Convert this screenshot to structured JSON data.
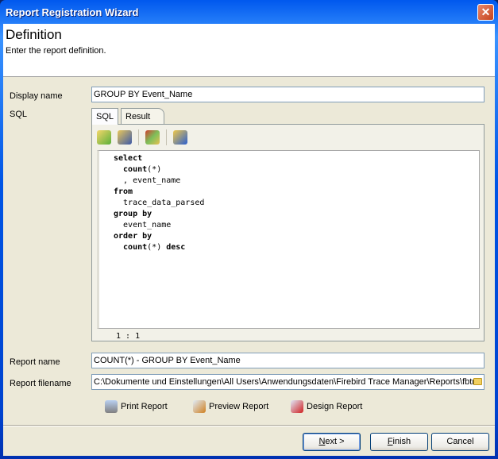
{
  "window": {
    "title": "Report Registration Wizard",
    "close": "✕"
  },
  "header": {
    "title": "Definition",
    "subtitle": "Enter the report definition."
  },
  "form": {
    "display_name_label": "Display name",
    "display_name_value": "GROUP BY Event_Name",
    "sql_label": "SQL",
    "report_name_label": "Report name",
    "report_name_value": "COUNT(*) - GROUP BY Event_Name",
    "report_filename_label": "Report filename",
    "report_filename_value": "C:\\Dokumente und Einstellungen\\All Users\\Anwendungsdaten\\Firebird Trace Manager\\Reports\\fbtr"
  },
  "tabs": [
    {
      "label": "SQL",
      "active": true
    },
    {
      "label": "Result",
      "active": false
    }
  ],
  "toolbar": {
    "icons": [
      "open-icon",
      "save-icon",
      "query-builder-icon",
      "execute-icon"
    ]
  },
  "editor": {
    "lines": [
      {
        "kw": "select",
        "rest": ""
      },
      {
        "kw": "  count",
        "rest": "(*)"
      },
      {
        "kw": "",
        "rest": "  , event_name"
      },
      {
        "kw": "from",
        "rest": ""
      },
      {
        "kw": "",
        "rest": "  trace_data_parsed"
      },
      {
        "kw": "group by",
        "rest": ""
      },
      {
        "kw": "",
        "rest": "  event_name"
      },
      {
        "kw": "order by",
        "rest": ""
      },
      {
        "kw": "  count",
        "rest": "(*) ",
        "kw2": "desc"
      }
    ],
    "status": "1 : 1"
  },
  "actions": {
    "print": "Print Report",
    "preview": "Preview Report",
    "design": "Design Report"
  },
  "buttons": {
    "next_u": "N",
    "next": "ext >",
    "finish_u": "F",
    "finish": "inish",
    "cancel": "Cancel"
  }
}
